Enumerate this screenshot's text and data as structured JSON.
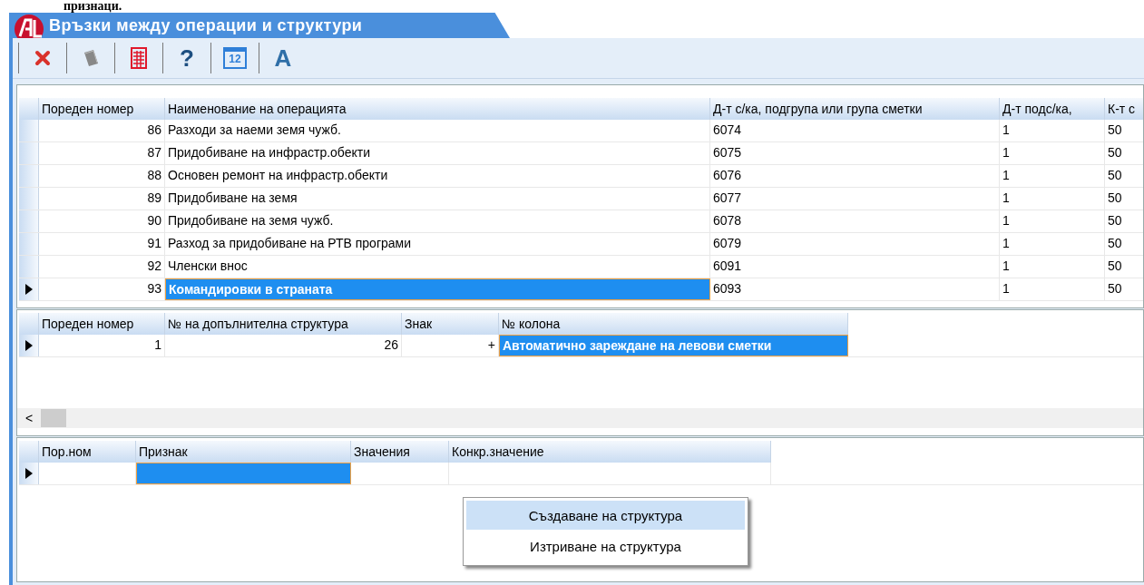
{
  "document_text": "признаци.",
  "window": {
    "title": "Връзки между  операции и структури"
  },
  "toolbar": [
    {
      "kind": "close"
    },
    {
      "kind": "book"
    },
    {
      "kind": "calculator"
    },
    {
      "kind": "help",
      "label": "?"
    },
    {
      "kind": "calendar",
      "label": "12"
    },
    {
      "kind": "font",
      "label": "A"
    }
  ],
  "grids": [
    {
      "columns": [
        {
          "label": "Пореден номер",
          "kind": "number",
          "focused": false
        },
        {
          "label": "Наименование на операцията",
          "kind": "text",
          "focused": true
        },
        {
          "label": "Д-т с/ка, подгрупа или група сметки",
          "kind": "text",
          "focused": false
        },
        {
          "label": "Д-т подс/ка,",
          "kind": "text",
          "focused": false
        },
        {
          "label": "К-т с",
          "kind": "text",
          "focused": false
        }
      ],
      "rows": [
        {
          "selected": false,
          "cells": [
            "86",
            "Разходи за наеми земя чужб.",
            "6074",
            "1",
            "50"
          ]
        },
        {
          "selected": false,
          "cells": [
            "87",
            "Придобиване на инфрастр.обекти",
            "6075",
            "1",
            "50"
          ]
        },
        {
          "selected": false,
          "cells": [
            "88",
            "Основен ремонт на инфрастр.обекти",
            "6076",
            "1",
            "50"
          ]
        },
        {
          "selected": false,
          "cells": [
            "89",
            "Придобиване на земя",
            "6077",
            "1",
            "50"
          ]
        },
        {
          "selected": false,
          "cells": [
            "90",
            "Придобиване на земя чужб.",
            "6078",
            "1",
            "50"
          ]
        },
        {
          "selected": false,
          "cells": [
            "91",
            "Разход за придобиване на РТВ програми",
            "6079",
            "1",
            "50"
          ]
        },
        {
          "selected": false,
          "cells": [
            "92",
            "Членски внос",
            "6091",
            "1",
            "50"
          ]
        },
        {
          "selected": true,
          "cells": [
            "93",
            "Командировки в страната",
            "6093",
            "1",
            "50"
          ]
        }
      ]
    },
    {
      "columns": [
        {
          "label": "Пореден номер",
          "kind": "number",
          "focused": false
        },
        {
          "label": "№ на допълнителна структура",
          "kind": "number",
          "focused": false
        },
        {
          "label": "Знак",
          "kind": "number",
          "focused": false
        },
        {
          "label": "№ колона",
          "kind": "text",
          "focused": true
        }
      ],
      "rows": [
        {
          "selected": true,
          "cells": [
            "1",
            "26",
            "+",
            "Автоматично зареждане на левови сметки"
          ]
        }
      ],
      "scroll_left": "<"
    },
    {
      "columns": [
        {
          "label": "Пор.ном",
          "kind": "text",
          "focused": false
        },
        {
          "label": "Признак",
          "kind": "text",
          "focused": true
        },
        {
          "label": "Значения",
          "kind": "text",
          "focused": false
        },
        {
          "label": "Конкр.значение",
          "kind": "text",
          "focused": false
        }
      ],
      "rows": [
        {
          "selected": true
        }
      ]
    }
  ],
  "context_menu": [
    {
      "label": "Създаване на структура",
      "selected": true
    },
    {
      "label": "Изтриване на структура",
      "selected": false
    }
  ]
}
